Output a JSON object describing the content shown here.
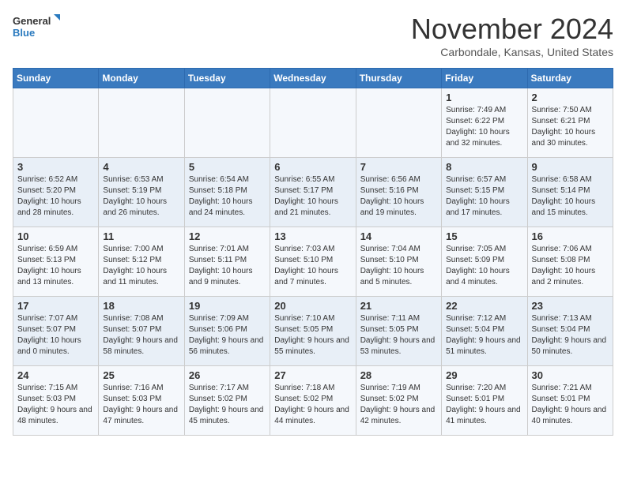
{
  "header": {
    "logo_line1": "General",
    "logo_line2": "Blue",
    "month_title": "November 2024",
    "location": "Carbondale, Kansas, United States"
  },
  "weekdays": [
    "Sunday",
    "Monday",
    "Tuesday",
    "Wednesday",
    "Thursday",
    "Friday",
    "Saturday"
  ],
  "weeks": [
    [
      {
        "day": "",
        "info": ""
      },
      {
        "day": "",
        "info": ""
      },
      {
        "day": "",
        "info": ""
      },
      {
        "day": "",
        "info": ""
      },
      {
        "day": "",
        "info": ""
      },
      {
        "day": "1",
        "info": "Sunrise: 7:49 AM\nSunset: 6:22 PM\nDaylight: 10 hours and 32 minutes."
      },
      {
        "day": "2",
        "info": "Sunrise: 7:50 AM\nSunset: 6:21 PM\nDaylight: 10 hours and 30 minutes."
      }
    ],
    [
      {
        "day": "3",
        "info": "Sunrise: 6:52 AM\nSunset: 5:20 PM\nDaylight: 10 hours and 28 minutes."
      },
      {
        "day": "4",
        "info": "Sunrise: 6:53 AM\nSunset: 5:19 PM\nDaylight: 10 hours and 26 minutes."
      },
      {
        "day": "5",
        "info": "Sunrise: 6:54 AM\nSunset: 5:18 PM\nDaylight: 10 hours and 24 minutes."
      },
      {
        "day": "6",
        "info": "Sunrise: 6:55 AM\nSunset: 5:17 PM\nDaylight: 10 hours and 21 minutes."
      },
      {
        "day": "7",
        "info": "Sunrise: 6:56 AM\nSunset: 5:16 PM\nDaylight: 10 hours and 19 minutes."
      },
      {
        "day": "8",
        "info": "Sunrise: 6:57 AM\nSunset: 5:15 PM\nDaylight: 10 hours and 17 minutes."
      },
      {
        "day": "9",
        "info": "Sunrise: 6:58 AM\nSunset: 5:14 PM\nDaylight: 10 hours and 15 minutes."
      }
    ],
    [
      {
        "day": "10",
        "info": "Sunrise: 6:59 AM\nSunset: 5:13 PM\nDaylight: 10 hours and 13 minutes."
      },
      {
        "day": "11",
        "info": "Sunrise: 7:00 AM\nSunset: 5:12 PM\nDaylight: 10 hours and 11 minutes."
      },
      {
        "day": "12",
        "info": "Sunrise: 7:01 AM\nSunset: 5:11 PM\nDaylight: 10 hours and 9 minutes."
      },
      {
        "day": "13",
        "info": "Sunrise: 7:03 AM\nSunset: 5:10 PM\nDaylight: 10 hours and 7 minutes."
      },
      {
        "day": "14",
        "info": "Sunrise: 7:04 AM\nSunset: 5:10 PM\nDaylight: 10 hours and 5 minutes."
      },
      {
        "day": "15",
        "info": "Sunrise: 7:05 AM\nSunset: 5:09 PM\nDaylight: 10 hours and 4 minutes."
      },
      {
        "day": "16",
        "info": "Sunrise: 7:06 AM\nSunset: 5:08 PM\nDaylight: 10 hours and 2 minutes."
      }
    ],
    [
      {
        "day": "17",
        "info": "Sunrise: 7:07 AM\nSunset: 5:07 PM\nDaylight: 10 hours and 0 minutes."
      },
      {
        "day": "18",
        "info": "Sunrise: 7:08 AM\nSunset: 5:07 PM\nDaylight: 9 hours and 58 minutes."
      },
      {
        "day": "19",
        "info": "Sunrise: 7:09 AM\nSunset: 5:06 PM\nDaylight: 9 hours and 56 minutes."
      },
      {
        "day": "20",
        "info": "Sunrise: 7:10 AM\nSunset: 5:05 PM\nDaylight: 9 hours and 55 minutes."
      },
      {
        "day": "21",
        "info": "Sunrise: 7:11 AM\nSunset: 5:05 PM\nDaylight: 9 hours and 53 minutes."
      },
      {
        "day": "22",
        "info": "Sunrise: 7:12 AM\nSunset: 5:04 PM\nDaylight: 9 hours and 51 minutes."
      },
      {
        "day": "23",
        "info": "Sunrise: 7:13 AM\nSunset: 5:04 PM\nDaylight: 9 hours and 50 minutes."
      }
    ],
    [
      {
        "day": "24",
        "info": "Sunrise: 7:15 AM\nSunset: 5:03 PM\nDaylight: 9 hours and 48 minutes."
      },
      {
        "day": "25",
        "info": "Sunrise: 7:16 AM\nSunset: 5:03 PM\nDaylight: 9 hours and 47 minutes."
      },
      {
        "day": "26",
        "info": "Sunrise: 7:17 AM\nSunset: 5:02 PM\nDaylight: 9 hours and 45 minutes."
      },
      {
        "day": "27",
        "info": "Sunrise: 7:18 AM\nSunset: 5:02 PM\nDaylight: 9 hours and 44 minutes."
      },
      {
        "day": "28",
        "info": "Sunrise: 7:19 AM\nSunset: 5:02 PM\nDaylight: 9 hours and 42 minutes."
      },
      {
        "day": "29",
        "info": "Sunrise: 7:20 AM\nSunset: 5:01 PM\nDaylight: 9 hours and 41 minutes."
      },
      {
        "day": "30",
        "info": "Sunrise: 7:21 AM\nSunset: 5:01 PM\nDaylight: 9 hours and 40 minutes."
      }
    ]
  ]
}
